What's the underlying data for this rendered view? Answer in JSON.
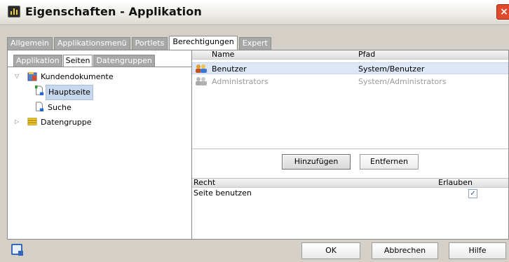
{
  "window": {
    "title": "Eigenschaften - Applikation",
    "close_glyph": "×"
  },
  "tabs": [
    {
      "label": "Allgemein",
      "active": false
    },
    {
      "label": "Applikationsmenü",
      "active": false
    },
    {
      "label": "Portlets",
      "active": false
    },
    {
      "label": "Berechtigungen",
      "active": true
    },
    {
      "label": "Expert",
      "active": false
    }
  ],
  "left": {
    "subtabs": [
      {
        "label": "Applikation",
        "active": false
      },
      {
        "label": "Seiten",
        "active": true
      },
      {
        "label": "Datengruppen",
        "active": false
      }
    ],
    "tree": [
      {
        "label": "Kundendokumente",
        "icon": "folder-document-icon",
        "expanded": true
      },
      {
        "label": "Hauptseite",
        "icon": "page-start-icon",
        "selected": true
      },
      {
        "label": "Suche",
        "icon": "page-icon"
      },
      {
        "label": "Datengruppe",
        "icon": "database-icon",
        "expanded": false
      }
    ]
  },
  "members": {
    "columns": [
      "Name",
      "Pfad"
    ],
    "rows": [
      {
        "name": "Benutzer",
        "path": "System/Benutzer",
        "selected": true,
        "enabled": true
      },
      {
        "name": "Administrators",
        "path": "System/Administrators",
        "selected": false,
        "enabled": false
      }
    ]
  },
  "actions": {
    "add": "Hinzufügen",
    "remove": "Entfernen"
  },
  "rights": {
    "columns": [
      "Recht",
      "Erlauben"
    ],
    "rows": [
      {
        "label": "Seite benutzen",
        "allowed": true,
        "check_glyph": "✓"
      }
    ]
  },
  "dialog": {
    "ok": "OK",
    "cancel": "Abbrechen",
    "help": "Hilfe"
  },
  "colors": {
    "selection": "#dde7f7",
    "inactive_tab": "#a8a8a8",
    "close": "#e04a2a"
  }
}
